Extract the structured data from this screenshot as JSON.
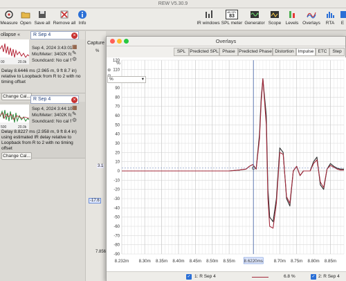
{
  "window": {
    "title": "REW V5.30.9"
  },
  "toolbar": {
    "left": [
      {
        "label": "Measure",
        "icon": "measure-icon"
      },
      {
        "label": "Open",
        "icon": "folder-icon"
      },
      {
        "label": "Save all",
        "icon": "save-icon"
      },
      {
        "label": "Remove all",
        "icon": "remove-all-icon"
      },
      {
        "label": "Info",
        "icon": "info-icon"
      }
    ],
    "right": [
      {
        "label": "IR windows",
        "icon": "ir-windows-icon"
      },
      {
        "label": "SPL meter",
        "icon": "spl-meter-icon",
        "badge": "83",
        "badge_unit": "dB SPL"
      },
      {
        "label": "Generator",
        "icon": "generator-icon"
      },
      {
        "label": "Scope",
        "icon": "scope-icon"
      },
      {
        "label": "Levels",
        "icon": "levels-icon"
      },
      {
        "label": "Overlays",
        "icon": "overlays-icon"
      },
      {
        "label": "RTA",
        "icon": "rta-icon"
      },
      {
        "label": "E",
        "icon": "eq-icon"
      }
    ]
  },
  "sidebar": {
    "collapse_label": "ollapse «",
    "capture_label": "Capture",
    "measurements": [
      {
        "name": "R Sep 4",
        "date": "Sep 4, 2024 3:43:01",
        "mic": "Mic/Meter: 3402K fc",
        "soundcard": "Soundcard: No cal f",
        "axis_left": "00",
        "axis_right": "20.0k",
        "description": "Delay 8.6446 ms (2.965 m, 9 ft 8.7 in) relative to Loopback from  R to  2 with no timing offset",
        "button": "Change Cal..."
      },
      {
        "name": "R Sep 4",
        "date": "Sep 4, 2024 3:44:10",
        "mic": "Mic/Meter: 3402K fc",
        "soundcard": "Soundcard: No cal f",
        "axis_left": "500",
        "axis_right": "20.0k",
        "description": "Delay 8.8227 ms (2.958 m, 9 ft 8.4 in) using estimated IR delay relative to Loopback from  R to  2 with no timing offset",
        "button": "Change Cal..."
      }
    ],
    "capture_values": [
      "%",
      "3.1",
      "-17.6",
      "7.856"
    ]
  },
  "overlays": {
    "title": "Overlays",
    "tabs": [
      "SPL",
      "Predicted SPL",
      "Phase",
      "Predicted Phase",
      "Distortion",
      "Impulse",
      "ETC",
      "Step"
    ],
    "active_tab": "Impulse",
    "unit_select": "%",
    "status": {
      "trace1_label": "1: R Sep 4",
      "trace2_label": "2: R Sep 4",
      "readout": "6.8 %"
    }
  },
  "chart_data": {
    "type": "line",
    "xlabel": "",
    "ylabel": "%",
    "xlim": [
      8.232,
      8.89
    ],
    "ylim": [
      -90,
      120
    ],
    "grid": true,
    "x_ticks": [
      "8.232m",
      "8.30m",
      "8.35m",
      "8.40m",
      "8.45m",
      "8.50m",
      "8.55m",
      "8.6220ms",
      "8.70m",
      "8.75m",
      "8.80m",
      "8.85m"
    ],
    "y_ticks": [
      120,
      110,
      100,
      90,
      80,
      70,
      60,
      50,
      40,
      30,
      20,
      10,
      0,
      -10,
      -20,
      -30,
      -40,
      -50,
      -60,
      -70,
      -80,
      -90
    ],
    "cursor_x": 8.622,
    "cursor_y": 3.1,
    "series": [
      {
        "color": "#2b2b2b",
        "x": [
          8.232,
          8.55,
          8.58,
          8.6,
          8.61,
          8.62,
          8.63,
          8.64,
          8.645,
          8.65,
          8.66,
          8.665,
          8.67,
          8.68,
          8.69,
          8.7,
          8.71,
          8.72,
          8.73,
          8.74,
          8.75,
          8.76,
          8.77,
          8.78,
          8.79,
          8.8,
          8.81,
          8.82,
          8.83,
          8.84,
          8.85,
          8.86,
          8.87,
          8.88,
          8.89
        ],
        "y": [
          0,
          0,
          1,
          2,
          5,
          7,
          2,
          40,
          80,
          100,
          60,
          -20,
          -50,
          -55,
          -30,
          25,
          20,
          -30,
          -38,
          0,
          5,
          -5,
          0,
          0,
          0,
          10,
          15,
          -15,
          -20,
          2,
          8,
          5,
          3,
          2,
          2
        ]
      },
      {
        "color": "#a3283a",
        "x": [
          8.232,
          8.55,
          8.58,
          8.6,
          8.61,
          8.62,
          8.63,
          8.64,
          8.645,
          8.65,
          8.66,
          8.665,
          8.67,
          8.68,
          8.69,
          8.7,
          8.71,
          8.72,
          8.73,
          8.74,
          8.75,
          8.76,
          8.77,
          8.78,
          8.79,
          8.8,
          8.81,
          8.82,
          8.83,
          8.84,
          8.85,
          8.86,
          8.87,
          8.88,
          8.89
        ],
        "y": [
          0,
          0,
          1,
          2,
          5,
          7,
          2,
          35,
          75,
          100,
          50,
          -30,
          -60,
          -62,
          -35,
          20,
          18,
          -28,
          -35,
          0,
          5,
          -5,
          0,
          0,
          0,
          8,
          12,
          -12,
          -18,
          2,
          6,
          4,
          2,
          1,
          1
        ]
      }
    ]
  },
  "colors": {
    "accent": "#1f3d7a",
    "trace_black": "#2b2b2b",
    "trace_red": "#a3283a",
    "close_red": "#c83232"
  }
}
